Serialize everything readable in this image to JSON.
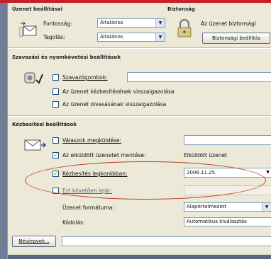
{
  "groups": {
    "general": "Üzenet beállításai",
    "security": "Biztonság",
    "voting": "Szavazási és nyomkövetési beállítások",
    "delivery": "Kézbesítési beállítások"
  },
  "general": {
    "importance_label": "Fontosság:",
    "importance_value": "Általános",
    "sensitivity_label": "Tagolás:",
    "sensitivity_value": "Általános"
  },
  "security": {
    "text": "Az üzenet biztonsági",
    "button": "Biztonsági beállítás"
  },
  "voting": {
    "voting_buttons_label": "Szavazógombok:",
    "voting_buttons_value": "",
    "delivery_receipt_label": "Az üzenet kézbesítésének visszaigazolása",
    "read_receipt_label": "Az üzenet olvasásának visszaigazolása"
  },
  "delivery": {
    "replies_to_label": "Válaszok megküldése:",
    "replies_to_value": "",
    "save_sent_label": "Az elküldött üzenetet mentése:",
    "save_sent_value": "Elküldött üzenet",
    "do_not_deliver_label": "Kézbesítés legkorábban:",
    "do_not_deliver_value": "2006.11.25.",
    "expires_label": "Ezt követően lejár:",
    "expires_value": "",
    "format_label": "Üzenet formátuma:",
    "format_value": "Alapértelmezett",
    "encoding_label": "Kódolás:",
    "encoding_value": "Automatikus kiválasztás",
    "contacts_button": "Névjegyek..."
  },
  "colors": {
    "highlight": "#c0392b",
    "check": "#21a121",
    "top_strip": "#c8202a"
  }
}
